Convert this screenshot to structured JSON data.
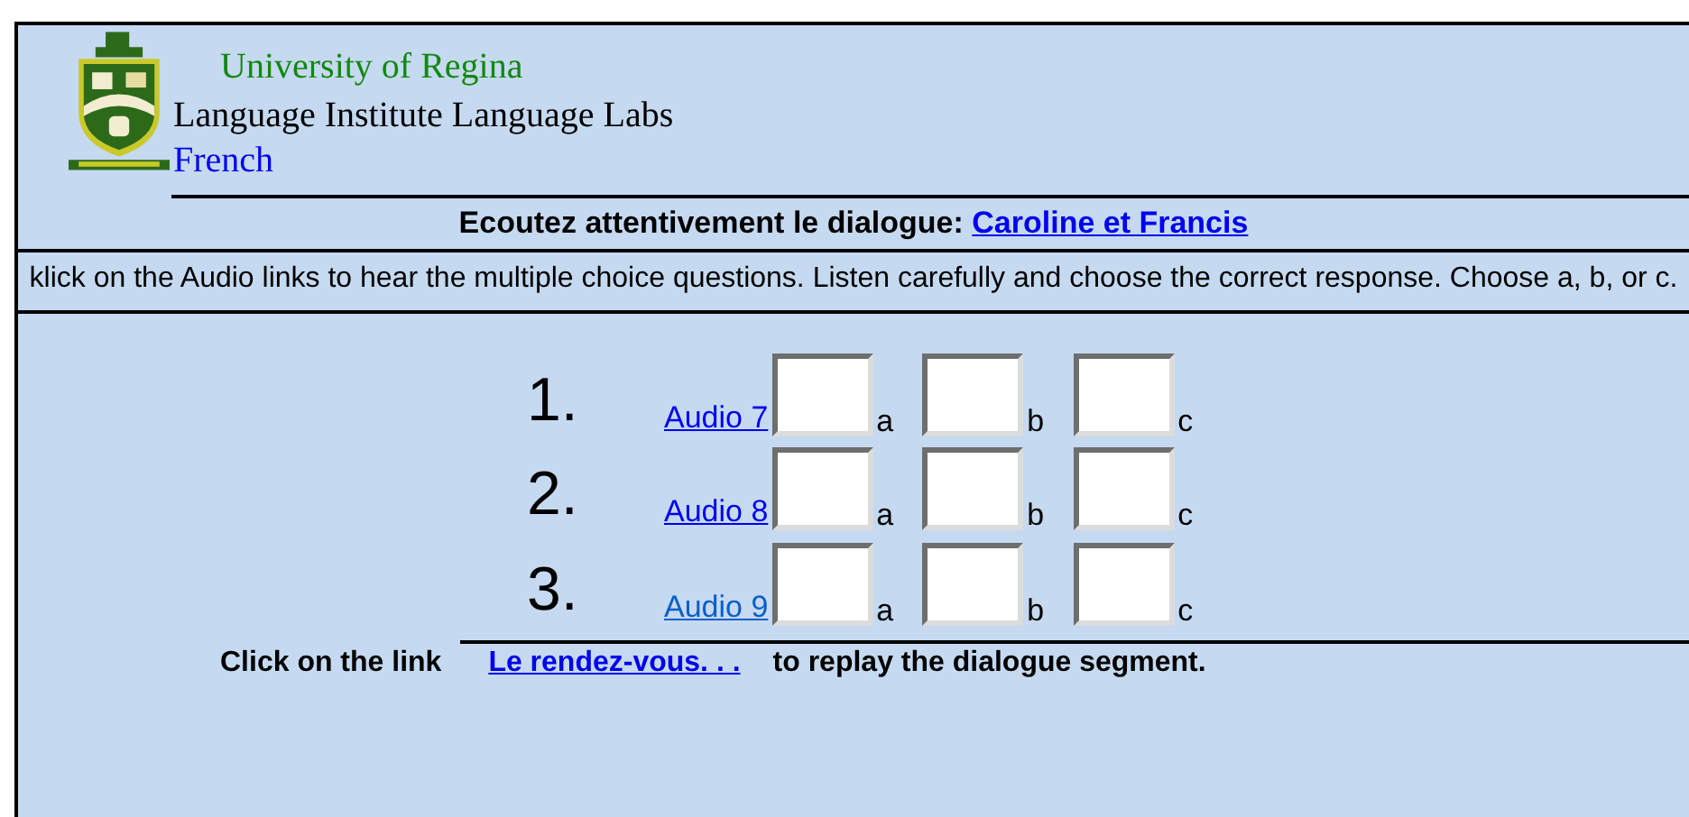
{
  "header": {
    "university": "University of Regina",
    "institute": "Language Institute Language Labs",
    "language": "French"
  },
  "title": {
    "text": "Ecoutez attentivement le dialogue:",
    "link": "Caroline et Francis"
  },
  "instructions": "klick on the Audio links to hear the multiple choice questions. Listen carefully and choose the correct response. Choose a, b, or c.",
  "questions": [
    {
      "number": "1.",
      "link": "Audio 7",
      "visited": false,
      "options": [
        "a",
        "b",
        "c"
      ]
    },
    {
      "number": "2.",
      "link": "Audio 8",
      "visited": false,
      "options": [
        "a",
        "b",
        "c"
      ]
    },
    {
      "number": "3.",
      "link": "Audio 9",
      "visited": true,
      "options": [
        "a",
        "b",
        "c"
      ]
    }
  ],
  "footer": {
    "before": "Click on the link",
    "link": "Le rendez-vous. . .",
    "after": "to replay the dialogue segment."
  }
}
